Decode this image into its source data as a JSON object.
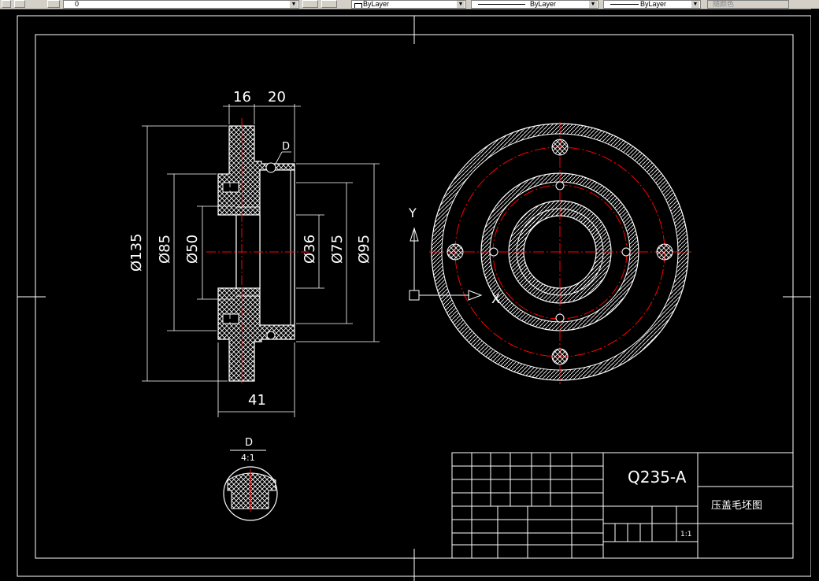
{
  "toolbar": {
    "layer_name": "0",
    "color_value": "ByLayer",
    "linetype_value": "ByLayer",
    "lineweight_value": "ByLayer",
    "plotstyle_value": "随颜色"
  },
  "drawing": {
    "dims": {
      "w16": "16",
      "w20": "20",
      "w41": "41",
      "d135": "Ø135",
      "d85": "Ø85",
      "d50": "Ø50",
      "d36": "Ø36",
      "d75": "Ø75",
      "d95": "Ø95"
    },
    "detail_label": "D",
    "detail_section_label": "D",
    "detail_scale": "4:1",
    "ucs_y": "Y",
    "ucs_x": "X"
  },
  "title_block": {
    "material": "Q235-A",
    "part_name": "压盖毛坯图",
    "scale": "1:1"
  },
  "colors": {
    "background": "#000000",
    "lines": "#ffffff",
    "center_lines": "#ff0000",
    "toolbar": "#d4d0c8"
  }
}
